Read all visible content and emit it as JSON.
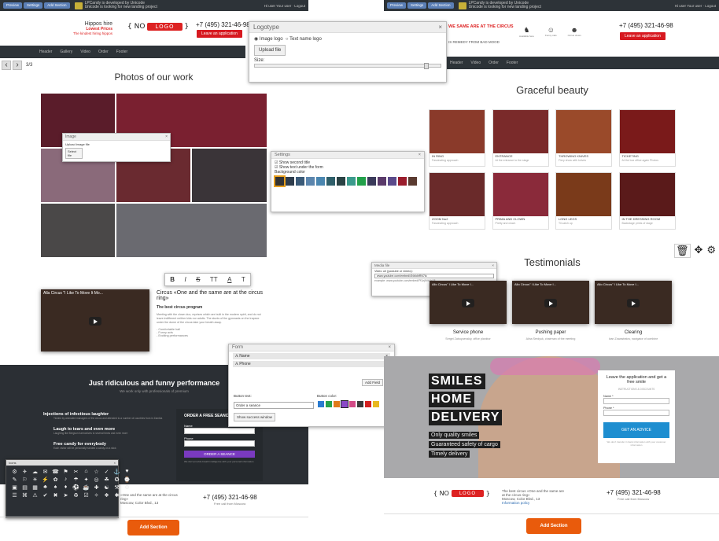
{
  "toolbar": {
    "btn1": "Preview",
    "btn2": "Settings",
    "btn3": "Add Section",
    "unc_line1": "LPCandy is developed by Unicode",
    "unc_line2": "Unicode is looking for new landing project",
    "right": "Hi user   Your user · Logout"
  },
  "left_header": {
    "brand": "Hippos hire",
    "price": "Lowest Prices",
    "tagline": "The kindest hiring hippos",
    "no_label": "NO",
    "logo_label": "LOGO",
    "phone": "+7 (495) 321-46-98",
    "cta": "Leave an application"
  },
  "left_nav": [
    "Header",
    "Gallery",
    "Video",
    "Order",
    "Footer"
  ],
  "pager": "3/3",
  "photos_title": "Photos of our work",
  "image_dialog": {
    "title": "Image",
    "label": "Upload image file",
    "button": "Select file"
  },
  "logotype_dialog": {
    "title": "Logotype",
    "opt1": "Image logo",
    "opt2": "Text name logo",
    "upload": "Upload file",
    "size_label": "Size:"
  },
  "settings_dialog": {
    "title": "Settings",
    "chk1": "Show second title",
    "chk2": "Show text under the form",
    "bg_label": "Background color",
    "colors": [
      "#333333",
      "#2e3c4c",
      "#3a5a78",
      "#5b85ad",
      "#4a86b0",
      "#2f5f6a",
      "#2a4244",
      "#3a9a8c",
      "#22a04a",
      "#3a3a5a",
      "#5a3a6a",
      "#5a4a8a",
      "#9a1c2c",
      "#5a3a30"
    ]
  },
  "editor_toolbar": [
    "B",
    "I",
    "S",
    "TT",
    "A",
    "T"
  ],
  "circus": {
    "video_title": "Alla Circus \"I Like To Move It Mo...",
    "title": "Circus «One and the same are at the circus ring»",
    "subtitle": "The best circus program",
    "body": "Meeting with the clown duo, reprises which are built in the modern spirit, and do not leave indifferent neither kids nor adults. The stunts of the gymnasts on the trapeze under the dome of the circus take your breath away.",
    "list": [
      "- Comfortable hall",
      "- Funny acts",
      "- Exciting performances"
    ]
  },
  "form_dialog": {
    "title": "Form",
    "f1": "Name",
    "f2": "Phone",
    "add": "Add Field",
    "btn_text_label": "Button text:",
    "btn_text_value": "Order a seance",
    "btn_color_label": "Button color:",
    "show_success": "Show success window",
    "colors": [
      "#2a7bd0",
      "#27a24b",
      "#e07b1a",
      "#8a4ac8",
      "#d24a86",
      "#3a3a3a",
      "#d22020",
      "#e8b820"
    ]
  },
  "funny": {
    "title": "Just ridiculous and funny performance",
    "sub": "We work only with professionals of premium",
    "items": [
      {
        "title": "Injections of infectious laughter",
        "desc": "Tickled by animated managers of the circus and attended to a number of countries from in Zambia"
      },
      {
        "title": "Laugh to tears and even more",
        "desc": "Laughing like Bergson harmonizes to several times and even more"
      },
      {
        "title": "Free candy for everybody",
        "desc": "Each visitor will be personally handed a candy on a stick"
      }
    ],
    "form_title": "ORDER A FREE SEANCE",
    "name_label": "Name",
    "phone_label": "Phone",
    "submit": "ORDER A SEANCE",
    "note": "We don't provide breath intelligence with your personal information"
  },
  "icons_panel": {
    "title": "Icons"
  },
  "left_footer": {
    "line1": "«One and the same are at the circus ring»",
    "line2": "Moscow, Color Blvd., 13",
    "phone": "+7 (495) 321-46-98",
    "free": "Free call from Moscow"
  },
  "add_section": "Add Section",
  "right_header": {
    "tagline": "WE SAME ARE AT THE CIRCUS",
    "remedy": "IS REMEDY FROM BAD MOOD",
    "icons": [
      {
        "name": "elephant-icon",
        "label": "Available here"
      },
      {
        "name": "monkey-icon",
        "label": "Funny cats"
      },
      {
        "name": "clown-icon",
        "label": "Circus clown"
      }
    ],
    "phone": "+7 (495) 321-46-98",
    "cta": "Leave an application"
  },
  "right_nav": [
    "Header",
    "Video",
    "Order",
    "Footer"
  ],
  "beauty_title": "Graceful beauty",
  "cards": [
    {
      "t1": "IN RING",
      "t2": "Fascinating approach",
      "color": "#8a3a2a"
    },
    {
      "t1": "ENTRANCE",
      "t2": "At the entrance to the stage",
      "color": "#7a2a2a"
    },
    {
      "t1": "THROWING KNIVES",
      "t2": "Fiery show with knives",
      "color": "#9a4a2a"
    },
    {
      "t1": "TICKETING",
      "t2": "At the box office again Photos",
      "color": "#7a1a1a"
    },
    {
      "t1": "ZOOM No2",
      "t2": "Fascinating approach",
      "color": "#6a2a2a"
    },
    {
      "t1": "PRIMA AND CLOWN",
      "t2": "Pretty and clown",
      "color": "#8a2a3a"
    },
    {
      "t1": "LONG LEGS",
      "t2": "Til catch up",
      "color": "#7a3a1a"
    },
    {
      "t1": "IN THE DRESSING ROOM",
      "t2": "Backstage prints of stage",
      "color": "#5a1a1a"
    }
  ],
  "controls": {
    "delete": "delete-icon",
    "move": "move-icon",
    "gear": "gear-icon"
  },
  "media_dialog": {
    "title": "Media file",
    "label": "Video url (youtube or vimeo):",
    "value": "www.youtube.com/embed/4NbIdhRN7ik",
    "example": "example: www.youtube.com/embed/Pl3zj9Vk0c18"
  },
  "testimonials_title": "Testimonials",
  "testimonials": [
    {
      "video": "Allo Circus\" I Like To Move I...",
      "name": "Service phone",
      "role": "Sergei Zabuyuevskiy, office planktor"
    },
    {
      "video": "Allo Circus\" I Like To Move I...",
      "name": "Pushing paper",
      "role": "Alina Serdyuk, chairman of the meeting"
    },
    {
      "video": "Allo Circus\" I Like To Move I...",
      "name": "Clearing",
      "role": "Ivan Zowastratov, navigator of combine"
    }
  ],
  "smiles": {
    "tags": [
      "SMILES",
      "HOME",
      "DELIVERY"
    ],
    "small": [
      "Only quality smiles",
      "Guaranteed safety of cargo",
      "Timely delivery"
    ],
    "form_title": "Leave the application and get a free smile",
    "form_sub": "INSTRUCTIONS & DISCOUNTS",
    "name_label": "Name *",
    "phone_label": "Phone *",
    "submit": "GET AN ADVICE",
    "note": "We don't transfer in bank information with your customer information"
  },
  "right_footer": {
    "no_label": "NO",
    "logo_label": "LOGO",
    "line1": "The best circus «One and the same are at the circus ring»",
    "line2": "Moscow, Color Blvd., 13",
    "link": "Information policy",
    "phone": "+7 (495) 321-46-98",
    "free": "Free call from Moscow"
  }
}
